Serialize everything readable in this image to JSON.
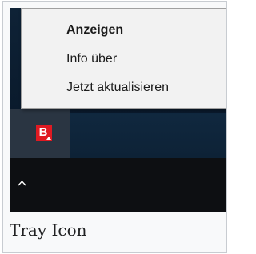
{
  "context_menu": {
    "items": [
      {
        "label": "Anzeigen",
        "default": true
      },
      {
        "label": "Info über",
        "default": false
      },
      {
        "label": "Jetzt aktualisieren",
        "default": false
      }
    ]
  },
  "tray": {
    "app_icon": {
      "name": "avira-tray-icon",
      "letter": "B",
      "color": "#e01a22"
    },
    "overflow_icon": "chevron-up-icon"
  },
  "caption": "Tray Icon"
}
